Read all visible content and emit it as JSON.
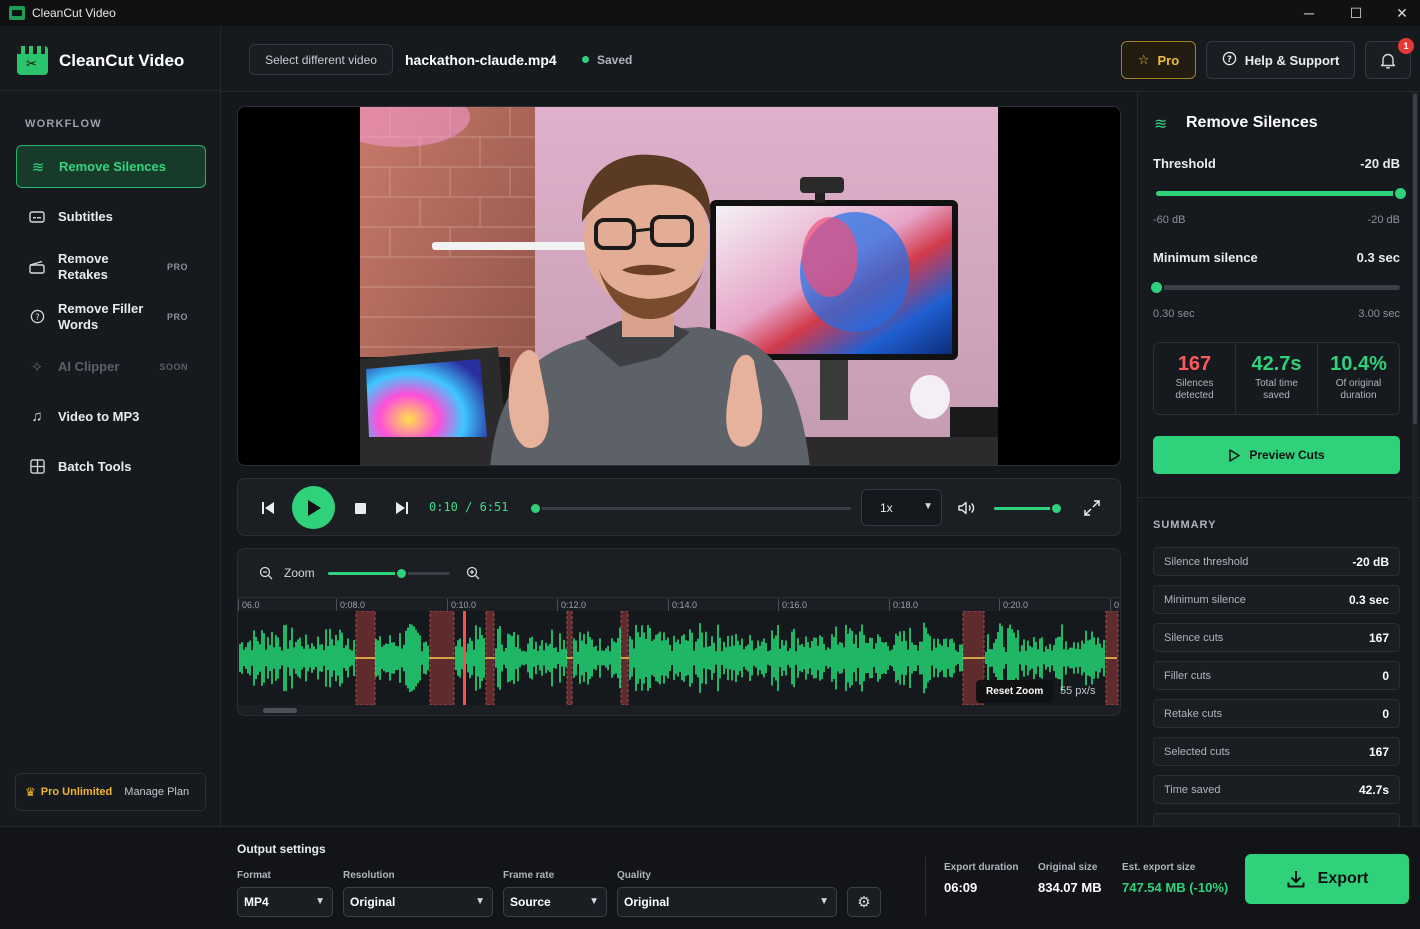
{
  "window": {
    "title": "CleanCut Video"
  },
  "brand": {
    "name": "CleanCut Video"
  },
  "sidebar": {
    "section": "WORKFLOW",
    "items": [
      {
        "label": "Remove Silences",
        "tag": ""
      },
      {
        "label": "Subtitles",
        "tag": ""
      },
      {
        "label": "Remove Retakes",
        "tag": "PRO"
      },
      {
        "label": "Remove Filler Words",
        "tag": "PRO"
      },
      {
        "label": "AI Clipper",
        "tag": "SOON"
      },
      {
        "label": "Video to MP3",
        "tag": ""
      },
      {
        "label": "Batch Tools",
        "tag": ""
      }
    ],
    "plan": {
      "name": "Pro Unlimited",
      "action": "Manage Plan"
    }
  },
  "header": {
    "select_video": "Select different video",
    "file_name": "hackathon-claude.mp4",
    "status": "Saved",
    "pro_label": "Pro",
    "help_label": "Help & Support",
    "notification_count": "1"
  },
  "player": {
    "time": "0:10 / 6:51",
    "progress": 0.025,
    "speed": "1x",
    "volume": 0.95
  },
  "timeline": {
    "zoom_label": "Zoom",
    "zoom_level": 0.6,
    "ticks": [
      "06.0",
      "0:08.0",
      "0:10.0",
      "0:12.0",
      "0:14.0",
      "0:16.0",
      "0:18.0",
      "0:20.0",
      "0:"
    ],
    "reset_zoom": "Reset Zoom",
    "scale": "55 px/s"
  },
  "panel": {
    "title": "Remove Silences",
    "threshold": {
      "label": "Threshold",
      "value": "-20 dB",
      "min": "-60 dB",
      "max": "-20 dB",
      "level": 1.0
    },
    "min_silence": {
      "label": "Minimum silence",
      "value": "0.3 sec",
      "min": "0.30 sec",
      "max": "3.00 sec",
      "level": 0.0
    },
    "stats": [
      {
        "value": "167",
        "caption": "Silences detected",
        "color": "#ff5a5a"
      },
      {
        "value": "42.7s",
        "caption": "Total time saved",
        "color": "#2fd27b"
      },
      {
        "value": "10.4%",
        "caption": "Of original duration",
        "color": "#2fd27b"
      }
    ],
    "preview_label": "Preview Cuts",
    "summary_label": "SUMMARY",
    "summary": [
      {
        "k": "Silence threshold",
        "v": "-20 dB"
      },
      {
        "k": "Minimum silence",
        "v": "0.3 sec"
      },
      {
        "k": "Silence cuts",
        "v": "167"
      },
      {
        "k": "Filler cuts",
        "v": "0"
      },
      {
        "k": "Retake cuts",
        "v": "0"
      },
      {
        "k": "Selected cuts",
        "v": "167"
      },
      {
        "k": "Time saved",
        "v": "42.7s"
      }
    ]
  },
  "output": {
    "title": "Output settings",
    "format": {
      "label": "Format",
      "value": "MP4"
    },
    "resolution": {
      "label": "Resolution",
      "value": "Original"
    },
    "frame_rate": {
      "label": "Frame rate",
      "value": "Source"
    },
    "quality": {
      "label": "Quality",
      "value": "Original"
    },
    "export_duration": {
      "label": "Export duration",
      "value": "06:09"
    },
    "original_size": {
      "label": "Original size",
      "value": "834.07 MB"
    },
    "est_size": {
      "label": "Est. export size",
      "value": "747.54 MB (-10%)"
    },
    "export_label": "Export"
  },
  "colors": {
    "accent": "#2fd27b",
    "pro": "#f2bd3b",
    "danger": "#ff5a5a"
  }
}
